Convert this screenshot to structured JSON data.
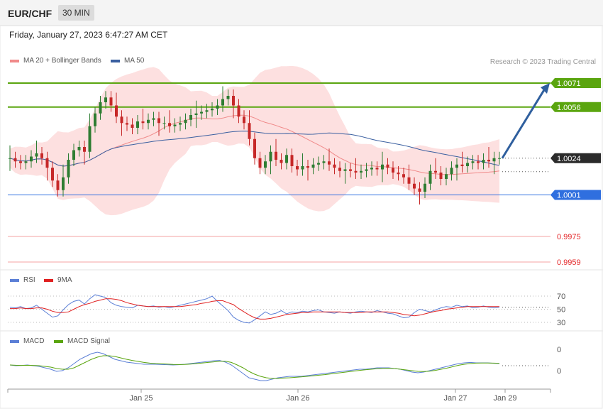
{
  "header": {
    "symbol": "EUR/CHF",
    "timeframe": "30 MIN"
  },
  "datetime": "Friday, January 27, 2023 6:47:27 AM CET",
  "credit": "Research © 2023 Trading Central",
  "colors": {
    "support": "#2f6fdf",
    "resistance": "#5aa50f",
    "target": "#e4282a",
    "ma20": "#f08a8a",
    "ma50": "#3a5fa0",
    "bollinger": "#fde0e0",
    "rsi": "#5b7fd6",
    "rsi_ma": "#e02020",
    "macd": "#5b7fd6",
    "macd_signal": "#5aa50f",
    "up_candle": "#2e7d32",
    "down_candle": "#c62828",
    "arrow": "#2f5f9e"
  },
  "chart_data": [
    {
      "type": "candlestick",
      "title": "EUR/CHF",
      "legend": [
        "MA 20 + Bollinger Bands",
        "MA 50"
      ],
      "ylim": [
        0.9955,
        1.0083
      ],
      "x_ticks": [
        "Jan 25",
        "Jan 26",
        "Jan 27",
        "Jan 29"
      ],
      "current_price": "1.0024",
      "levels": [
        {
          "label": "1.0071",
          "value": 1.0071,
          "kind": "resistance"
        },
        {
          "label": "1.0056",
          "value": 1.0056,
          "kind": "resistance"
        },
        {
          "label": "1.0001",
          "value": 1.0001,
          "kind": "support"
        },
        {
          "label": "0.9975",
          "value": 0.9975,
          "kind": "target"
        },
        {
          "label": "0.9959",
          "value": 0.9959,
          "kind": "target"
        }
      ],
      "close_prices": [
        1.0024,
        1.0022,
        1.0021,
        1.0022,
        1.0025,
        1.0027,
        1.0024,
        1.0018,
        1.001,
        1.0004,
        1.0012,
        1.0023,
        1.0029,
        1.0031,
        1.0028,
        1.0044,
        1.0052,
        1.0059,
        1.0062,
        1.0057,
        1.005,
        1.0046,
        1.0045,
        1.0043,
        1.0047,
        1.0046,
        1.0048,
        1.0049,
        1.0046,
        1.0046,
        1.0044,
        1.0045,
        1.0046,
        1.0048,
        1.0051,
        1.0052,
        1.0053,
        1.0054,
        1.0055,
        1.0057,
        1.0061,
        1.0063,
        1.0057,
        1.005,
        1.0046,
        1.0036,
        1.0024,
        1.0018,
        1.0022,
        1.0028,
        1.0023,
        1.0021,
        1.0026,
        1.0019,
        1.0017,
        1.0019,
        1.0018,
        1.002,
        1.0021,
        1.0022,
        1.002,
        1.0018,
        1.0016,
        1.0017,
        1.0016,
        1.0015,
        1.0016,
        1.0017,
        1.0018,
        1.0017,
        1.002,
        1.0018,
        1.0015,
        1.0014,
        1.0012,
        1.0008,
        1.0005,
        1.0003,
        1.0008,
        1.0016,
        1.0015,
        1.0011,
        1.0014,
        1.0018,
        1.002,
        1.0019,
        1.0021,
        1.0022,
        1.0021,
        1.0023,
        1.0022,
        1.0024,
        1.0024
      ]
    },
    {
      "type": "line",
      "legend": [
        "RSI",
        "9MA"
      ],
      "ylim": [
        25,
        78
      ],
      "y_ticks": [
        "70",
        "50",
        "30"
      ],
      "series": [
        {
          "name": "RSI",
          "values": [
            53,
            52,
            54,
            51,
            52,
            56,
            50,
            44,
            38,
            40,
            49,
            57,
            62,
            64,
            58,
            66,
            72,
            70,
            68,
            60,
            56,
            54,
            53,
            52,
            56,
            55,
            54,
            55,
            53,
            54,
            52,
            54,
            56,
            58,
            60,
            62,
            64,
            66,
            70,
            62,
            55,
            48,
            38,
            33,
            30,
            29,
            34,
            40,
            46,
            42,
            44,
            48,
            43,
            46,
            45,
            47,
            46,
            48,
            49,
            46,
            45,
            44,
            46,
            45,
            44,
            46,
            47,
            46,
            45,
            48,
            46,
            44,
            43,
            40,
            37,
            38,
            45,
            50,
            48,
            46,
            49,
            52,
            54,
            53,
            56,
            54,
            55,
            52,
            53,
            55,
            53,
            52,
            53
          ]
        },
        {
          "name": "9MA",
          "values": [
            51,
            51,
            52,
            51,
            51,
            52,
            52,
            50,
            47,
            45,
            45,
            46,
            50,
            54,
            57,
            59,
            62,
            64,
            66,
            66,
            65,
            63,
            60,
            58,
            56,
            55,
            54,
            54,
            54,
            54,
            54,
            54,
            54,
            55,
            56,
            57,
            59,
            60,
            62,
            63,
            63,
            60,
            57,
            51,
            46,
            41,
            37,
            35,
            35,
            36,
            38,
            40,
            42,
            43,
            44,
            45,
            45,
            46,
            46,
            46,
            46,
            46,
            46,
            45,
            45,
            45,
            45,
            46,
            46,
            46,
            46,
            46,
            45,
            44,
            42,
            41,
            40,
            41,
            43,
            45,
            47,
            48,
            50,
            51,
            52,
            53,
            54,
            54,
            54,
            54,
            54,
            54,
            54
          ]
        }
      ]
    },
    {
      "type": "line",
      "legend": [
        "MACD",
        "MACD Signal"
      ],
      "y_ticks": [
        "0",
        "0"
      ],
      "ylim": [
        -12,
        12
      ],
      "series": [
        {
          "name": "MACD",
          "values": [
            0,
            -0.5,
            -0.3,
            0,
            -0.5,
            -1,
            -2,
            -3,
            -4.5,
            -4,
            -2,
            1,
            4,
            6,
            8,
            9,
            8,
            6,
            4,
            3,
            2,
            1.5,
            1,
            0.5,
            0.5,
            0.5,
            0.3,
            0.2,
            0,
            0.2,
            0.5,
            1,
            1.5,
            2,
            2.5,
            3,
            3.2,
            2,
            0,
            -3,
            -6,
            -9,
            -10,
            -11,
            -11,
            -10,
            -9,
            -8.5,
            -8,
            -8,
            -8,
            -7.5,
            -7,
            -6.5,
            -6,
            -5.5,
            -5,
            -4.5,
            -4,
            -3.5,
            -3,
            -3,
            -2.5,
            -2,
            -2,
            -2,
            -2.5,
            -3,
            -4,
            -5,
            -5.5,
            -5,
            -4,
            -3,
            -2,
            -1,
            0,
            1,
            1.5,
            1.8,
            1.5,
            1.5,
            1.5,
            1.2,
            1.0
          ]
        },
        {
          "name": "MACD Signal",
          "values": [
            0,
            -0.2,
            -0.3,
            -0.2,
            -0.3,
            -0.5,
            -1,
            -1.5,
            -2.5,
            -3,
            -3,
            -2,
            0,
            2,
            4,
            5.5,
            6.5,
            6.5,
            6,
            5,
            4,
            3.2,
            2.5,
            1.8,
            1.3,
            1,
            0.8,
            0.6,
            0.4,
            0.3,
            0.4,
            0.6,
            1,
            1.4,
            1.8,
            2.2,
            2.6,
            2.6,
            1.8,
            0,
            -2,
            -4.5,
            -6.5,
            -8,
            -9,
            -9.5,
            -9.5,
            -9.2,
            -9,
            -8.7,
            -8.4,
            -8,
            -7.6,
            -7.2,
            -6.8,
            -6.3,
            -5.8,
            -5.3,
            -4.8,
            -4.3,
            -3.8,
            -3.4,
            -3,
            -2.6,
            -2.4,
            -2.3,
            -2.5,
            -3,
            -3.5,
            -4,
            -4.5,
            -4.6,
            -4.4,
            -3.8,
            -3,
            -2.2,
            -1.2,
            -0.2,
            0.5,
            1,
            1.3,
            1.4,
            1.4,
            1.3,
            1.2
          ]
        }
      ]
    }
  ]
}
